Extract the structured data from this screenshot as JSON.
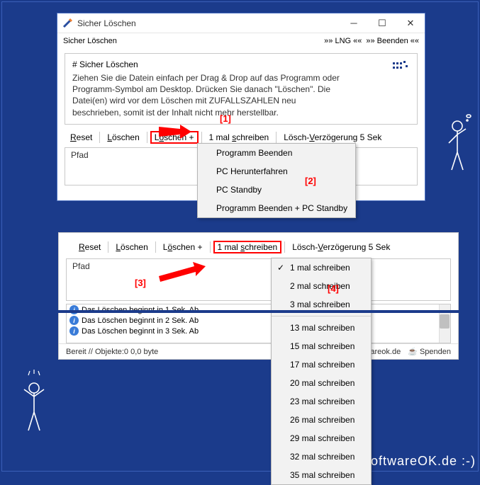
{
  "win1": {
    "title": "Sicher Löschen",
    "menu_title": "Sicher Löschen",
    "lng": "»» LNG ««",
    "beenden": "»» Beenden ««",
    "desc_title": "# Sicher Löschen",
    "desc_text": "Ziehen Sie die Datein einfach per Drag & Drop auf das Programm oder Programm-Symbol am Desktop. Drücken Sie danach \"Löschen\". Die Datei(en) wird vor dem Löschen mit ZUFALLSZAHLEN neu beschrieben, somit ist der Inhalt nicht mehr herstellbar.",
    "toolbar": {
      "reset": "Reset",
      "loeschen": "Löschen",
      "loeschen_plus": "Löschen +",
      "schreiben": "1 mal schreiben",
      "verzoegerung": "Lösch-Verzögerung 5 Sek"
    },
    "list_header": "Pfad",
    "dropdown1": {
      "i1": "Programm Beenden",
      "i2": "PC Herunterfahren",
      "i3": "PC Standby",
      "i4": "Programm Beenden + PC Standby"
    }
  },
  "callouts": {
    "c1": "[1]",
    "c2": "[2]",
    "c3": "[3]",
    "c4": "[4]"
  },
  "panel2": {
    "toolbar": {
      "reset": "Reset",
      "loeschen": "Löschen",
      "loeschen_plus": "Löschen +",
      "schreiben": "1 mal schreiben",
      "verzoegerung": "Lösch-Verzögerung 5 Sek"
    },
    "list_header": "Pfad",
    "log": {
      "l1": "Das Löschen beginnt in 1 Sek. Ab",
      "l2": "Das Löschen beginnt in 2 Sek. Ab",
      "l3": "Das Löschen beginnt in 3 Sek. Ab"
    },
    "status": "Bereit // Objekte:0 0,0 byte",
    "areok": "areok.de",
    "spenden": "Spenden"
  },
  "dd2": {
    "o1": "1 mal schreiben",
    "o2": "2 mal schreiben",
    "o3": "3 mal schreiben",
    "o4": "13 mal schreiben",
    "o5": "15 mal schreiben",
    "o6": "17 mal schreiben",
    "o7": "20 mal schreiben",
    "o8": "23 mal schreiben",
    "o9": "26 mal schreiben",
    "o10": "29 mal schreiben",
    "o11": "32 mal schreiben",
    "o12": "35 mal schreiben"
  },
  "watermark": "www.SoftwareOK.de :-)"
}
